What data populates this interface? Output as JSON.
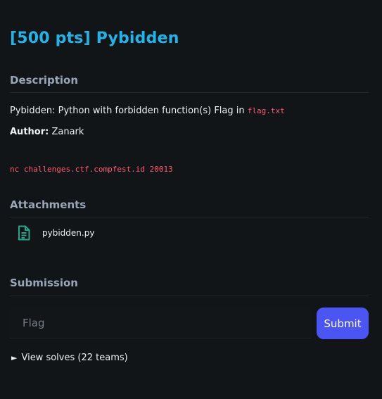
{
  "challenge": {
    "title": "[500 pts] Pybidden"
  },
  "sections": {
    "description": "Description",
    "attachments": "Attachments",
    "submission": "Submission"
  },
  "description": {
    "text": "Pybidden: Python with forbidden function(s) Flag in ",
    "flag_file": "flag.txt",
    "author_label": "Author:",
    "author_name": " Zanark",
    "command": "nc challenges.ctf.compfest.id 20013"
  },
  "attachments": [
    {
      "name": "pybidden.py",
      "icon": "file-document-icon"
    }
  ],
  "submission": {
    "placeholder": "Flag",
    "button_label": "Submit"
  },
  "solves": {
    "marker": "►",
    "label": "View solves (22 teams)"
  },
  "colors": {
    "background": "#111518",
    "title": "#1fb5e8",
    "accent_button": "#4b55f4",
    "code": "#ff5b6f",
    "file_icon": "#1ea98a"
  }
}
